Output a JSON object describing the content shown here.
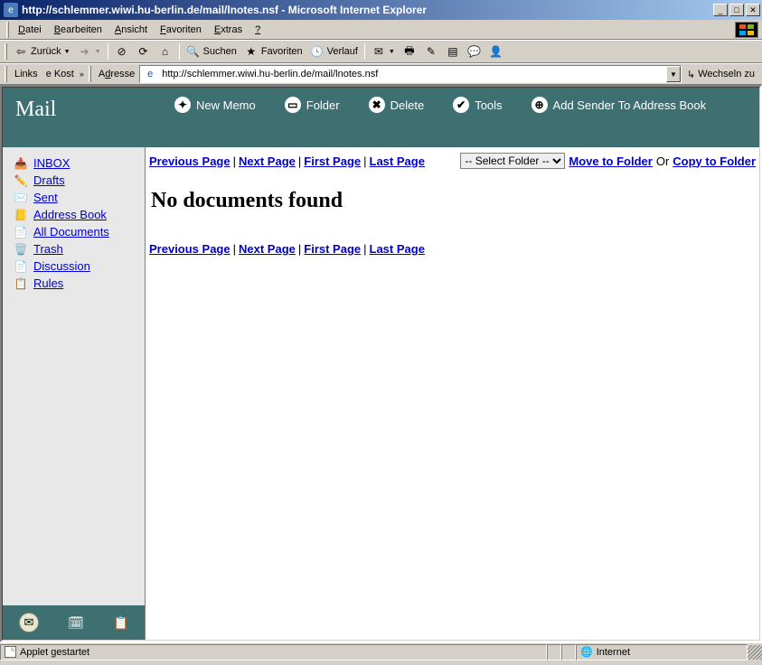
{
  "window": {
    "title": "http://schlemmer.wiwi.hu-berlin.de/mail/lnotes.nsf - Microsoft Internet Explorer"
  },
  "menu": {
    "items": [
      "Datei",
      "Bearbeiten",
      "Ansicht",
      "Favoriten",
      "Extras",
      "?"
    ]
  },
  "toolbar1": {
    "back": "Zurück",
    "search": "Suchen",
    "favorites": "Favoriten",
    "history": "Verlauf"
  },
  "addrbar": {
    "links_label": "Links",
    "kost": "Kost",
    "adresse_label": "Adresse",
    "url": "http://schlemmer.wiwi.hu-berlin.de/mail/lnotes.nsf",
    "go": "Wechseln zu"
  },
  "app": {
    "title": "Mail",
    "toolbar": {
      "new_memo": "New Memo",
      "folder": "Folder",
      "delete": "Delete",
      "tools": "Tools",
      "add_sender": "Add Sender To Address Book"
    }
  },
  "sidebar": {
    "items": [
      {
        "label": "INBOX"
      },
      {
        "label": "Drafts"
      },
      {
        "label": "Sent"
      },
      {
        "label": "Address Book"
      },
      {
        "label": "All Documents"
      },
      {
        "label": "Trash"
      },
      {
        "label": "Discussion"
      },
      {
        "label": "Rules"
      }
    ]
  },
  "main": {
    "pagenav": {
      "prev": "Previous Page",
      "next": "Next Page",
      "first": "First Page",
      "last": "Last Page"
    },
    "folder_select": {
      "placeholder": "-- Select Folder --",
      "move": "Move to Folder",
      "or": "Or",
      "copy": "Copy to Folder"
    },
    "message": "No documents found"
  },
  "statusbar": {
    "text": "Applet gestartet",
    "zone": "Internet"
  }
}
